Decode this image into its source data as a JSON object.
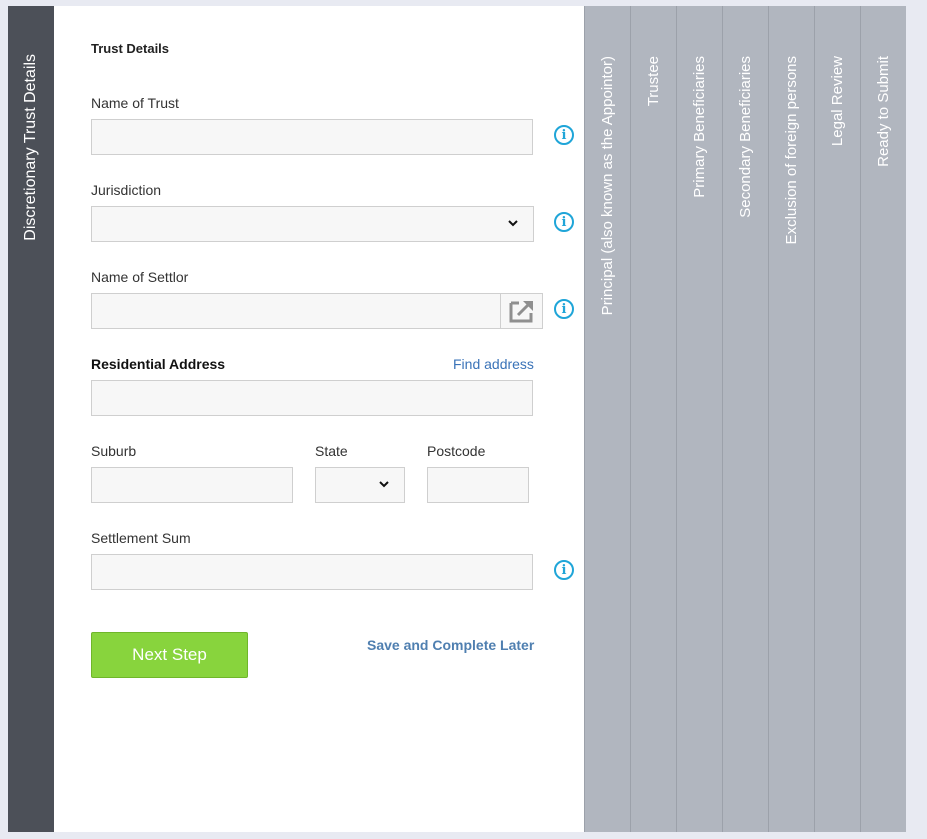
{
  "left_tab": {
    "label": "Discretionary Trust Details"
  },
  "form": {
    "section_title": "Trust Details",
    "name_of_trust": {
      "label": "Name of Trust",
      "value": ""
    },
    "jurisdiction": {
      "label": "Jurisdiction",
      "value": ""
    },
    "name_of_settlor": {
      "label": "Name of Settlor",
      "value": ""
    },
    "residential_address": {
      "label": "Residential Address",
      "find_link": "Find address",
      "value": ""
    },
    "suburb": {
      "label": "Suburb",
      "value": ""
    },
    "state": {
      "label": "State",
      "value": ""
    },
    "postcode": {
      "label": "Postcode",
      "value": ""
    },
    "settlement_sum": {
      "label": "Settlement Sum",
      "value": ""
    },
    "next_button": "Next Step",
    "save_later": "Save and Complete Later",
    "info_glyph": "i"
  },
  "steps": [
    {
      "label": "Principal (also known as the Appointor)"
    },
    {
      "label": "Trustee"
    },
    {
      "label": "Primary Beneficiaries"
    },
    {
      "label": "Secondary Beneficiaries"
    },
    {
      "label": "Exclusion of foreign persons"
    },
    {
      "label": "Legal Review"
    },
    {
      "label": "Ready to Submit"
    }
  ],
  "colors": {
    "left_tab": "#4c5058",
    "step_tab": "#b1b6bf",
    "accent_info": "#1fa5d8",
    "next_button": "#88d43d",
    "link": "#3a73b8"
  }
}
